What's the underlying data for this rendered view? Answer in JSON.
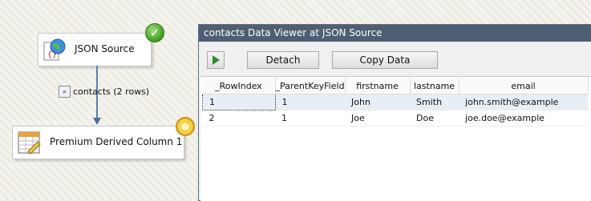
{
  "canvas": {
    "source_component": {
      "label": "JSON Source",
      "status": "success"
    },
    "derived_component": {
      "label": "Premium Derived Column 1",
      "status": "pending"
    },
    "path": {
      "label": "contacts (2 rows)"
    }
  },
  "viewer": {
    "title": "contacts Data Viewer at JSON Source",
    "toolbar": {
      "detach_label": "Detach",
      "copy_label": "Copy Data"
    },
    "columns": [
      "_RowIndex",
      "_ParentKeyField",
      "firstname",
      "lastname",
      "email"
    ],
    "rows": [
      [
        "1",
        "1",
        "John",
        "Smith",
        "john.smith@example"
      ],
      [
        "2",
        "1",
        "Joe",
        "Doe",
        "joe.doe@example"
      ]
    ]
  }
}
